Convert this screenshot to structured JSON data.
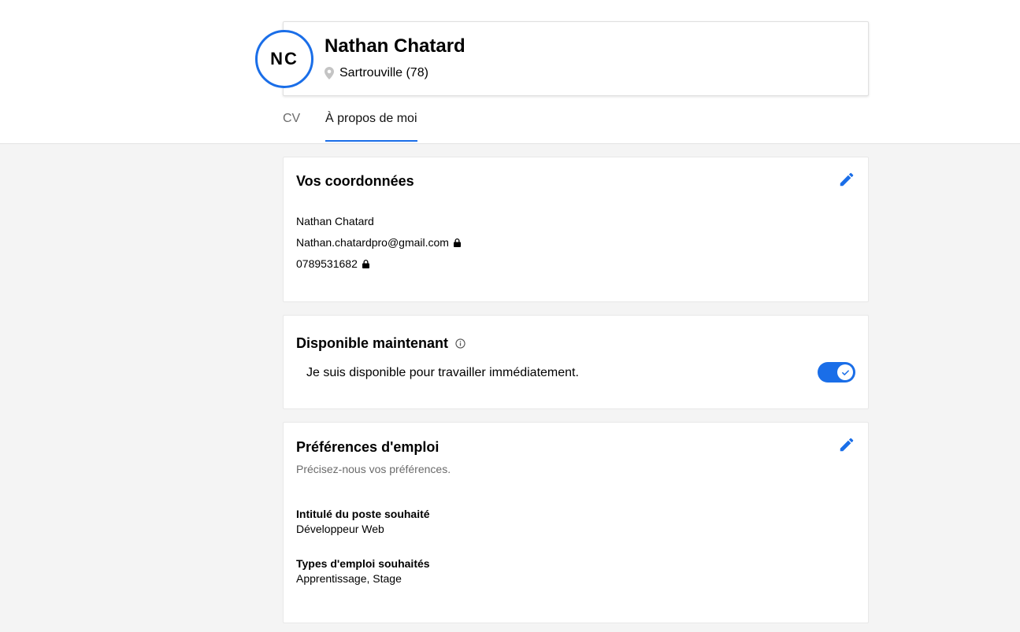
{
  "profile": {
    "initials": "NC",
    "name": "Nathan Chatard",
    "location": "Sartrouville (78)"
  },
  "tabs": [
    {
      "label": "CV",
      "active": false
    },
    {
      "label": "À propos de moi",
      "active": true
    }
  ],
  "contact": {
    "title": "Vos coordonnées",
    "name": "Nathan Chatard",
    "email": "Nathan.chatardpro@gmail.com",
    "phone": "0789531682"
  },
  "availability": {
    "title": "Disponible maintenant",
    "text": "Je suis disponible pour travailler immédiatement.",
    "enabled": true
  },
  "preferences": {
    "title": "Préférences d'emploi",
    "subtitle": "Précisez-nous vos préférences.",
    "job_title_label": "Intitulé du poste souhaité",
    "job_title_value": "Développeur Web",
    "job_types_label": "Types d'emploi souhaités",
    "job_types_value": "Apprentissage, Stage"
  },
  "colors": {
    "accent": "#1a6ee8",
    "background": "#f4f4f4"
  }
}
